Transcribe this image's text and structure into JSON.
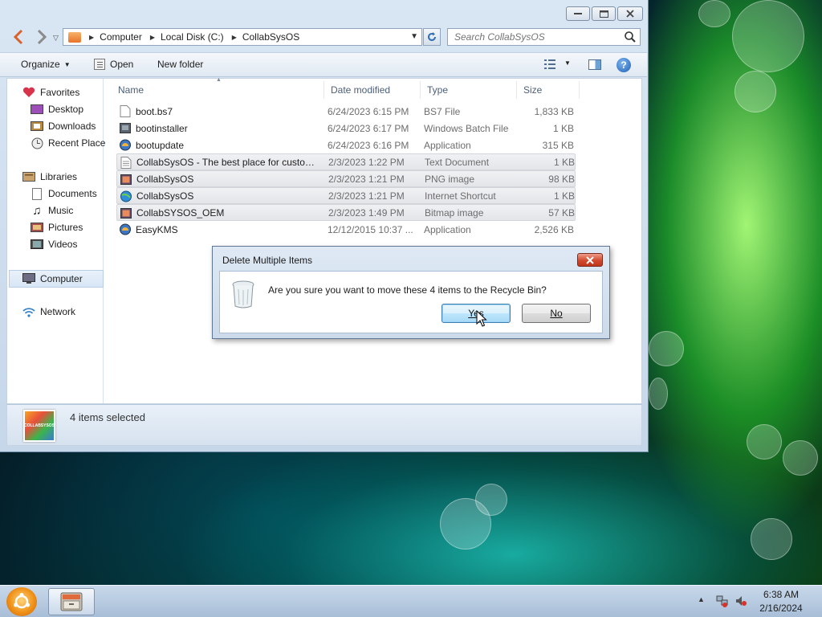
{
  "window": {
    "address": [
      "Computer",
      "Local Disk (C:)",
      "CollabSysOS"
    ],
    "search_placeholder": "Search CollabSysOS"
  },
  "toolbar": {
    "organize": "Organize",
    "open": "Open",
    "new_folder": "New folder"
  },
  "navpane": {
    "favorites": "Favorites",
    "desktop": "Desktop",
    "downloads": "Downloads",
    "recent": "Recent Place",
    "libraries": "Libraries",
    "documents": "Documents",
    "music": "Music",
    "pictures": "Pictures",
    "videos": "Videos",
    "computer": "Computer",
    "network": "Network"
  },
  "columns": {
    "name": "Name",
    "date": "Date modified",
    "type": "Type",
    "size": "Size"
  },
  "files": [
    {
      "name": "boot.bs7",
      "date": "6/24/2023 6:15 PM",
      "type": "BS7 File",
      "size": "1,833 KB",
      "selected": false,
      "icon": "blank-file-icon"
    },
    {
      "name": "bootinstaller",
      "date": "6/24/2023 6:17 PM",
      "type": "Windows Batch File",
      "size": "1 KB",
      "selected": false,
      "icon": "batch-file-icon"
    },
    {
      "name": "bootupdate",
      "date": "6/24/2023 6:16 PM",
      "type": "Application",
      "size": "315 KB",
      "selected": false,
      "icon": "app-icon"
    },
    {
      "name": "CollabSysOS - The best place for custom ...",
      "date": "2/3/2023 1:22 PM",
      "type": "Text Document",
      "size": "1 KB",
      "selected": true,
      "icon": "text-file-icon"
    },
    {
      "name": "CollabSysOS",
      "date": "2/3/2023 1:21 PM",
      "type": "PNG image",
      "size": "98 KB",
      "selected": true,
      "icon": "image-file-icon"
    },
    {
      "name": "CollabSysOS",
      "date": "2/3/2023 1:21 PM",
      "type": "Internet Shortcut",
      "size": "1 KB",
      "selected": true,
      "icon": "internet-shortcut-icon"
    },
    {
      "name": "CollabSYSOS_OEM",
      "date": "2/3/2023 1:49 PM",
      "type": "Bitmap image",
      "size": "57 KB",
      "selected": true,
      "icon": "image-file-icon"
    },
    {
      "name": "EasyKMS",
      "date": "12/12/2015 10:37 ...",
      "type": "Application",
      "size": "2,526 KB",
      "selected": false,
      "icon": "app-icon"
    }
  ],
  "status": {
    "text": "4 items selected",
    "logo_text": "COLLABSYSOS"
  },
  "dialog": {
    "title": "Delete Multiple Items",
    "message": "Are you sure you want to move these 4 items to the Recycle Bin?",
    "yes": "Yes",
    "no": "No"
  },
  "taskbar": {
    "time": "6:38 AM",
    "date": "2/16/2024"
  },
  "colors": {
    "selection": "#e3e5e9",
    "accent": "#3c7fb1",
    "close_red": "#d14a2d"
  }
}
